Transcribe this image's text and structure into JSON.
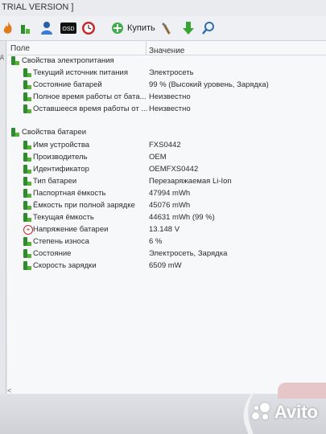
{
  "window": {
    "title": "TRIAL VERSION ]"
  },
  "toolbar": {
    "buy_label": "Купить",
    "icons": [
      "flame-icon",
      "battery-icon",
      "person-icon",
      "osd-icon",
      "clock-icon",
      "plus-icon",
      "tools-icon",
      "download-arrow-icon",
      "search-icon"
    ]
  },
  "columns": {
    "field": "Поле",
    "value": "Значение"
  },
  "power": {
    "title": "Свойства электропитания",
    "rows": [
      {
        "name": "Текущий источник питания",
        "value": "Электросеть"
      },
      {
        "name": "Состояние батарей",
        "value": "99 % (Высокий уровень, Зарядка)"
      },
      {
        "name": "Полное время работы от бата...",
        "value": "Неизвестно"
      },
      {
        "name": "Оставшееся время работы от ...",
        "value": "Неизвестно"
      }
    ]
  },
  "battery": {
    "title": "Свойства батареи",
    "rows": [
      {
        "name": "Имя устройства",
        "value": "FXS0442"
      },
      {
        "name": "Производитель",
        "value": "OEM"
      },
      {
        "name": "Идентификатор",
        "value": "OEMFXS0442"
      },
      {
        "name": "Тип батареи",
        "value": "Перезаряжаемая Li-Ion"
      },
      {
        "name": "Паспортная ёмкость",
        "value": "47994 mWh"
      },
      {
        "name": "Ёмкость при полной зарядке",
        "value": "45076 mWh"
      },
      {
        "name": "Текущая ёмкость",
        "value": "44631 mWh  (99 %)"
      },
      {
        "name": "Напряжение батареи",
        "value": "13.148 V"
      },
      {
        "name": "Степень износа",
        "value": "6 %"
      },
      {
        "name": "Состояние",
        "value": "Электросеть, Зарядка"
      },
      {
        "name": "Скорость зарядки",
        "value": "6509 mW"
      }
    ]
  },
  "watermark": {
    "text": "Avito"
  },
  "colors": {
    "accent_green": "#2e8b2e",
    "voltage_red": "#c1272d"
  }
}
